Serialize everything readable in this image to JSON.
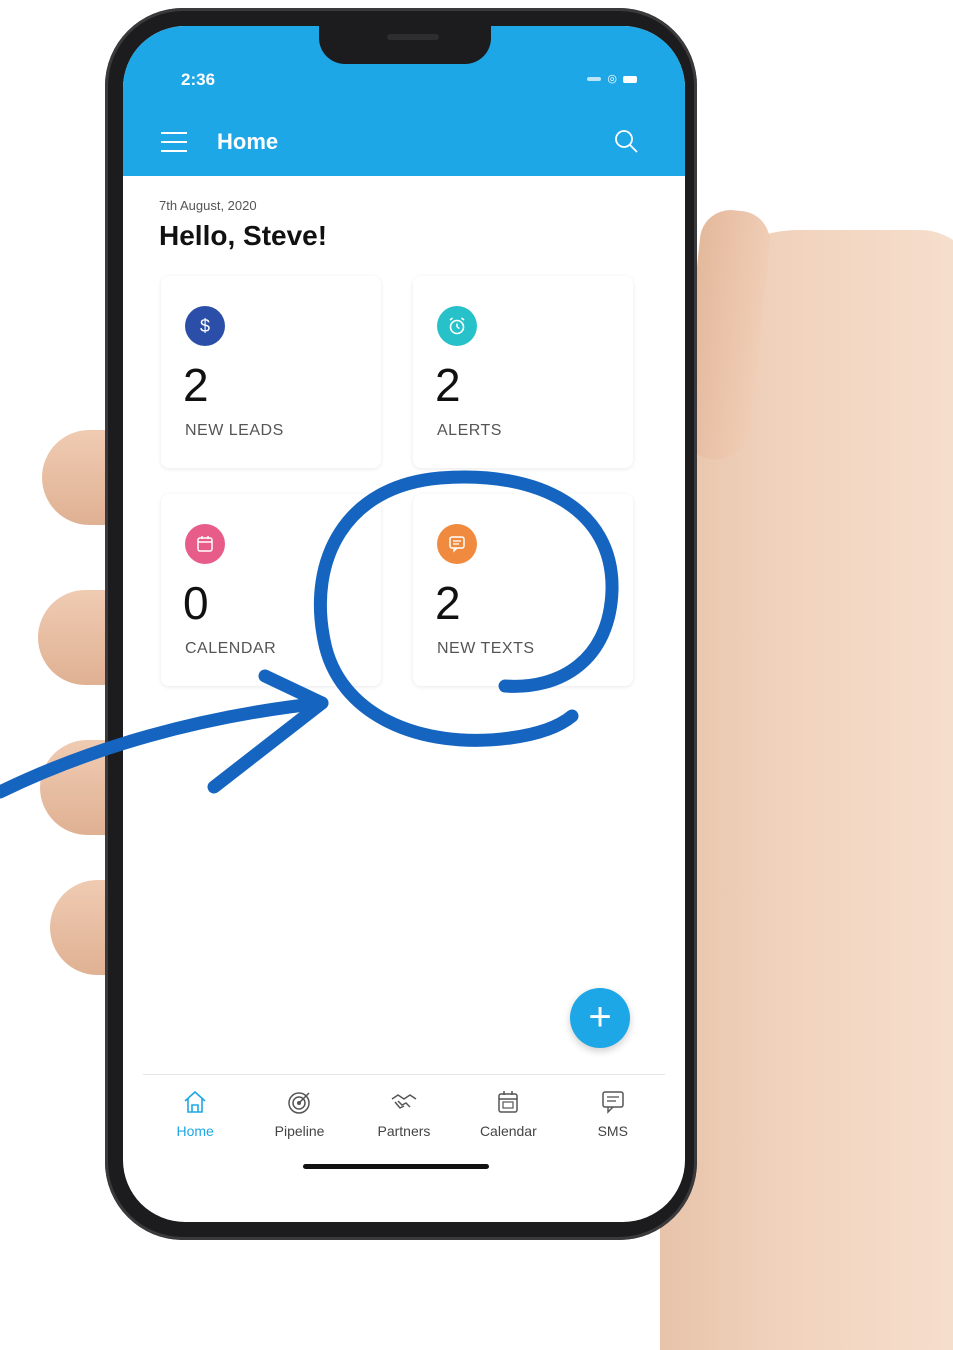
{
  "status_bar": {
    "time": "2:36"
  },
  "app_bar": {
    "title": "Home"
  },
  "greeting": {
    "date": "7th August, 2020",
    "text": "Hello, Steve!"
  },
  "cards": [
    {
      "value": "2",
      "label": "NEW LEADS",
      "icon": "dollar-icon",
      "color": "#2b4fa8"
    },
    {
      "value": "2",
      "label": "ALERTS",
      "icon": "alarm-icon",
      "color": "#27c2c9"
    },
    {
      "value": "0",
      "label": "CALENDAR",
      "icon": "calendar-icon",
      "color": "#e85c8a"
    },
    {
      "value": "2",
      "label": "NEW TEXTS",
      "icon": "message-icon",
      "color": "#f08a3e"
    }
  ],
  "bottom_nav": [
    {
      "label": "Home",
      "icon": "home-icon",
      "active": true
    },
    {
      "label": "Pipeline",
      "icon": "target-icon"
    },
    {
      "label": "Partners",
      "icon": "handshake-icon"
    },
    {
      "label": "Calendar",
      "icon": "calendar-icon"
    },
    {
      "label": "SMS",
      "icon": "chat-icon"
    }
  ],
  "colors": {
    "primary": "#1ea7e6",
    "annotation": "#1565c0"
  }
}
